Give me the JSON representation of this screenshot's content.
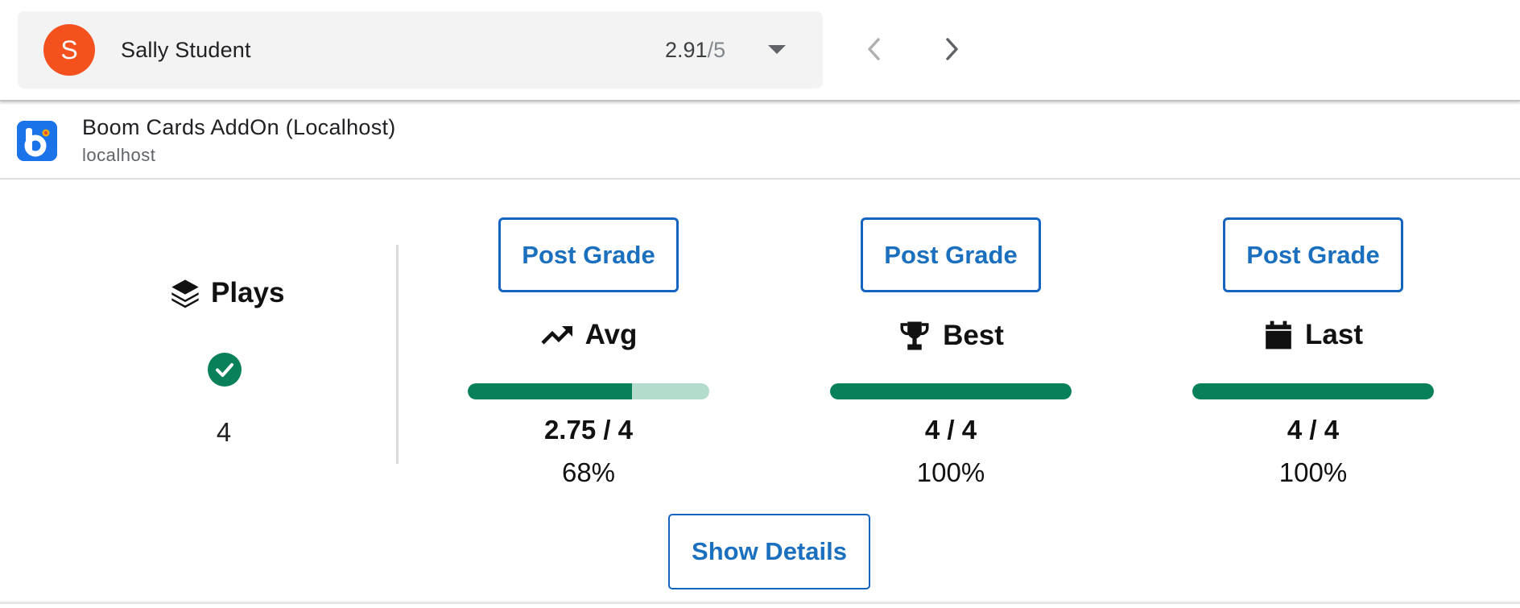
{
  "student": {
    "avatar_letter": "S",
    "avatar_color": "#f4511e",
    "name": "Sally Student",
    "grade_value": "2.91",
    "grade_separator": "/",
    "grade_max": "5",
    "dropdown_icon": "arrow-drop-down-icon",
    "prev_icon": "chevron-left-icon",
    "next_icon": "chevron-right-icon"
  },
  "addon": {
    "logo_letter": "b",
    "title": "Boom Cards AddOn (Localhost)",
    "subtitle": "localhost"
  },
  "plays": {
    "icon": "layers-icon",
    "label": "Plays",
    "status_icon": "check-circle-icon",
    "count": "4"
  },
  "metrics": [
    {
      "key": "avg",
      "button": "Post Grade",
      "icon": "trending-up-icon",
      "label": "Avg",
      "score": "2.75 / 4",
      "percent": "68%",
      "progress": 0.68
    },
    {
      "key": "best",
      "button": "Post Grade",
      "icon": "trophy-icon",
      "label": "Best",
      "score": "4 / 4",
      "percent": "100%",
      "progress": 1.0
    },
    {
      "key": "last",
      "button": "Post Grade",
      "icon": "calendar-icon",
      "label": "Last",
      "score": "4 / 4",
      "percent": "100%",
      "progress": 1.0
    }
  ],
  "details_button": "Show Details",
  "colors": {
    "accent": "#1a6fbf",
    "progress_fill": "#08805a",
    "progress_track": "#b4dccc",
    "success": "#08805a",
    "avatar": "#f4511e",
    "logo": "#1a73e8"
  }
}
